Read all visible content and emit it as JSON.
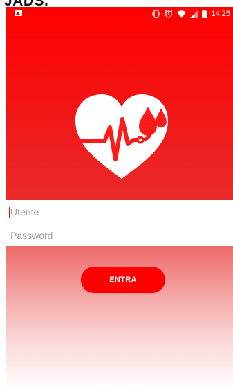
{
  "page": {
    "top_label": "JADS."
  },
  "status_bar": {
    "time": "14:25",
    "icons": [
      "gallery-icon",
      "vibrate-icon",
      "alarm-icon",
      "wifi-icon",
      "signal-icon",
      "battery-icon"
    ]
  },
  "hero": {
    "logo": "heart-blood-drop-icon",
    "background_color": "#ff0000"
  },
  "login": {
    "username_placeholder": "Utente",
    "password_placeholder": "Password",
    "submit_label": "ENTRA",
    "button_color": "#ff0000"
  }
}
